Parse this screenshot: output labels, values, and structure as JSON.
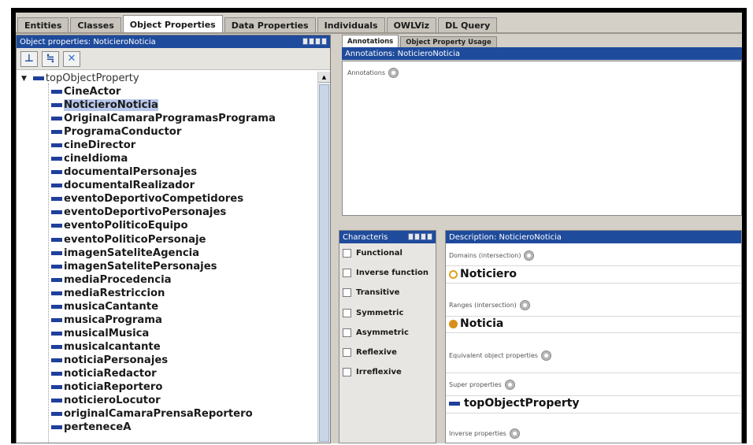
{
  "main_tabs": [
    "Entities",
    "Classes",
    "Object Properties",
    "Data Properties",
    "Individuals",
    "OWLViz",
    "DL Query"
  ],
  "main_tab_active_index": 2,
  "left_panel": {
    "title": "Object properties: NoticieroNoticia",
    "toolbar_icons": [
      "add-subproperty-icon",
      "add-sibling-property-icon",
      "delete-property-icon"
    ],
    "root": "topObjectProperty",
    "items": [
      "CineActor",
      "NoticieroNoticia",
      "OriginalCamaraProgramasPrograma",
      "ProgramaConductor",
      "cineDirector",
      "cineIdioma",
      "documentalPersonajes",
      "documentalRealizador",
      "eventoDeportivoCompetidores",
      "eventoDeportivoPersonajes",
      "eventoPoliticoEquipo",
      "eventoPoliticoPersonaje",
      "imagenSateliteAgencia",
      "imagenSatelitePersonajes",
      "mediaProcedencia",
      "mediaRestriccion",
      "musicaCantante",
      "musicaPrograma",
      "musicalMusica",
      "musicalcantante",
      "noticiaPersonajes",
      "noticiaRedactor",
      "noticiaReportero",
      "noticieroLocutor",
      "originalCamaraPrensaReportero",
      "perteneceA"
    ],
    "selected_index": 1
  },
  "annotations": {
    "tabs": [
      "Annotations",
      "Object Property Usage"
    ],
    "header": "Annotations: NoticieroNoticia",
    "label": "Annotations"
  },
  "characteristics": {
    "header": "Characteris",
    "items": [
      "Functional",
      "Inverse function",
      "Transitive",
      "Symmetric",
      "Asymmetric",
      "Reflexive",
      "Irreflexive"
    ]
  },
  "description": {
    "header": "Description: NoticieroNoticia",
    "domains_label": "Domains (intersection)",
    "domain_value": "Noticiero",
    "ranges_label": "Ranges (intersection)",
    "range_value": "Noticia",
    "equivalent_label": "Equivalent object properties",
    "super_label": "Super properties",
    "super_value": "topObjectProperty",
    "inverse_label": "Inverse properties"
  },
  "colors": {
    "header_blue": "#1f4b9c",
    "property_blue": "#1f3f9a",
    "class_orange": "#d89018",
    "selection": "#b8c8ec"
  }
}
